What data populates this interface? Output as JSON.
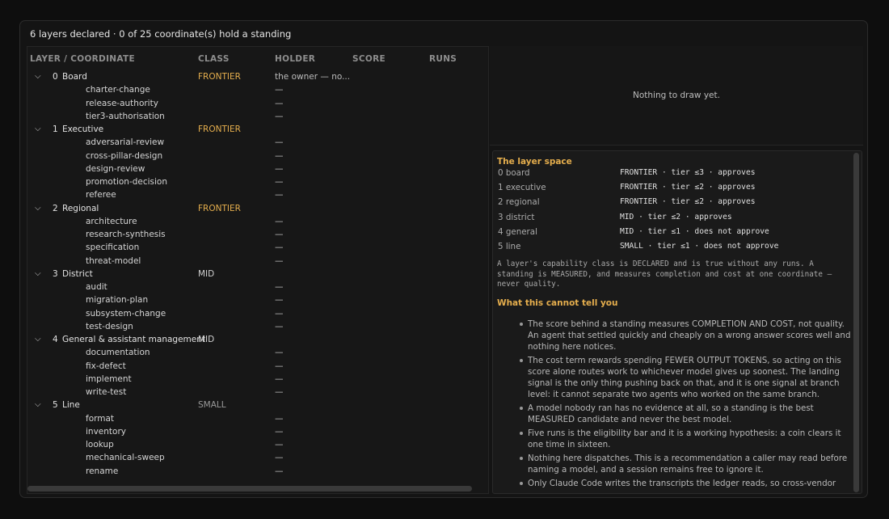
{
  "summary": "6 layers declared · 0 of 25 coordinate(s) hold a standing",
  "columns": [
    "LAYER / COORDINATE",
    "CLASS",
    "HOLDER",
    "SCORE",
    "RUNS"
  ],
  "tree": [
    {
      "num": "0",
      "name": "Board",
      "class": "FRONTIER",
      "holder": "the owner — no...",
      "coords": [
        "charter-change",
        "release-authority",
        "tier3-authorisation"
      ]
    },
    {
      "num": "1",
      "name": "Executive",
      "class": "FRONTIER",
      "holder": "",
      "coords": [
        "adversarial-review",
        "cross-pillar-design",
        "design-review",
        "promotion-decision",
        "referee"
      ]
    },
    {
      "num": "2",
      "name": "Regional",
      "class": "FRONTIER",
      "holder": "",
      "coords": [
        "architecture",
        "research-synthesis",
        "specification",
        "threat-model"
      ]
    },
    {
      "num": "3",
      "name": "District",
      "class": "MID",
      "holder": "",
      "coords": [
        "audit",
        "migration-plan",
        "subsystem-change",
        "test-design"
      ]
    },
    {
      "num": "4",
      "name": "General & assistant management",
      "class": "MID",
      "holder": "",
      "coords": [
        "documentation",
        "fix-defect",
        "implement",
        "write-test"
      ]
    },
    {
      "num": "5",
      "name": "Line",
      "class": "SMALL",
      "holder": "",
      "coords": [
        "format",
        "inventory",
        "lookup",
        "mechanical-sweep",
        "rename"
      ]
    }
  ],
  "empty_holder": "—",
  "viz": {
    "empty_text": "Nothing to draw yet."
  },
  "info": {
    "layer_space_title": "The layer space",
    "layer_space": [
      {
        "name": "0 board",
        "value": "FRONTIER · tier ≤3 · approves"
      },
      {
        "name": "1 executive",
        "value": "FRONTIER · tier ≤2 · approves"
      },
      {
        "name": "2 regional",
        "value": "FRONTIER · tier ≤2 · approves"
      },
      {
        "name": "3 district",
        "value": "MID · tier ≤2 · approves"
      },
      {
        "name": "4 general",
        "value": "MID · tier ≤1 · does not approve"
      },
      {
        "name": "5 line",
        "value": "SMALL · tier ≤1 · does not approve"
      }
    ],
    "note": "A layer's capability class is DECLARED and is true without any runs. A standing is MEASURED, and measures completion and cost at one coordinate — never quality.",
    "limits_title": "What this cannot tell you",
    "limits": [
      "The score behind a standing measures COMPLETION AND COST, not quality. An agent that settled quickly and cheaply on a wrong answer scores well and nothing here notices.",
      "The cost term rewards spending FEWER OUTPUT TOKENS, so acting on this score alone routes work to whichever model gives up soonest. The landing signal is the only thing pushing back on that, and it is one signal at branch level: it cannot separate two agents who worked on the same branch.",
      "A model nobody ran has no evidence at all, so a standing is the best MEASURED candidate and never the best model.",
      "Five runs is the eligibility bar and it is a working hypothesis: a coin clears it one time in sixteen.",
      "Nothing here dispatches. This is a recommendation a caller may read before naming a model, and a session remains free to ignore it.",
      "Only Claude Code writes the transcripts the ledger reads, so cross-vendor"
    ]
  }
}
